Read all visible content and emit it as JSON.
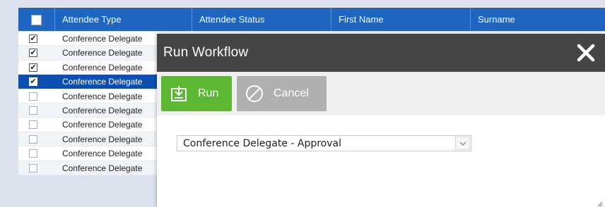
{
  "grid": {
    "columns": [
      "Attendee Type",
      "Attendee Status",
      "First Name",
      "Surname"
    ],
    "rows": [
      {
        "type": "Conference Delegate",
        "checked": true,
        "selected": false
      },
      {
        "type": "Conference Delegate",
        "checked": true,
        "selected": false
      },
      {
        "type": "Conference Delegate",
        "checked": true,
        "selected": false
      },
      {
        "type": "Conference Delegate",
        "checked": true,
        "selected": true
      },
      {
        "type": "Conference Delegate",
        "checked": false,
        "selected": false
      },
      {
        "type": "Conference Delegate",
        "checked": false,
        "selected": false
      },
      {
        "type": "Conference Delegate",
        "checked": false,
        "selected": false
      },
      {
        "type": "Conference Delegate",
        "checked": false,
        "selected": false
      },
      {
        "type": "Conference Delegate",
        "checked": false,
        "selected": false
      },
      {
        "type": "Conference Delegate",
        "checked": false,
        "selected": false
      }
    ],
    "check_glyph": "✔"
  },
  "dialog": {
    "title": "Run Workflow",
    "close_icon": "close-icon",
    "run_label": "Run",
    "cancel_label": "Cancel",
    "workflow_select": {
      "selected": "Conference Delegate - Approval"
    }
  },
  "colors": {
    "header_blue": "#1f66c1",
    "selected_row": "#0d4fb0",
    "run_green": "#5cb833",
    "cancel_grey": "#b0b0b0",
    "dialog_title_bg": "#454545"
  }
}
